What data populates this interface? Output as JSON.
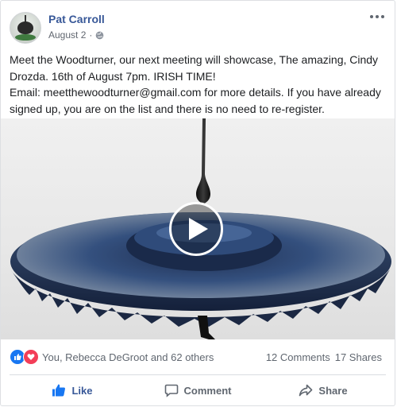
{
  "post": {
    "author": "Pat Carroll",
    "date": "August 2",
    "body_lines": [
      "Meet the Woodturner, our next meeting will showcase, The amazing, Cindy Drozda. 16th of August 7pm. IRISH TIME!",
      "Email: meetthewoodturner@gmail.com for more details. If you have already signed up, you are on the list and there is no need to re-register."
    ]
  },
  "media": {
    "type": "video",
    "play_icon": "play-icon"
  },
  "reactions": {
    "icons": [
      "like-reaction-icon",
      "love-reaction-icon"
    ],
    "summary": "You, Rebecca DeGroot and 62 others",
    "comments": "12 Comments",
    "shares": "17 Shares"
  },
  "actions": {
    "like": "Like",
    "comment": "Comment",
    "share": "Share"
  },
  "colors": {
    "link": "#385898",
    "like_blue": "#1877f2",
    "love_red": "#f33e58",
    "muted": "#606770"
  }
}
